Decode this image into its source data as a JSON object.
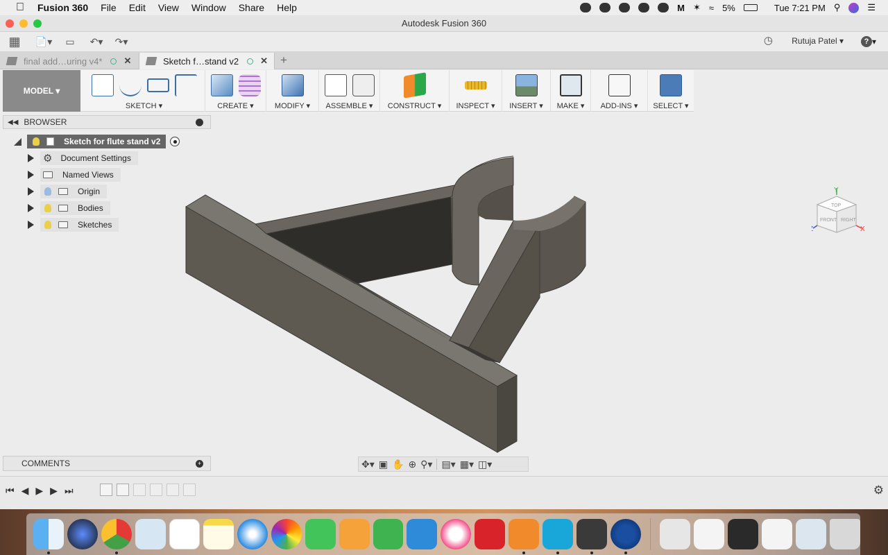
{
  "menubar": {
    "app_name": "Fusion 360",
    "items": [
      "File",
      "Edit",
      "View",
      "Window",
      "Share",
      "Help"
    ],
    "battery": "5%",
    "clock": "Tue 7:21 PM"
  },
  "window": {
    "title": "Autodesk Fusion 360"
  },
  "toolbar": {
    "user": "Rutuja Patel"
  },
  "tabs": [
    {
      "label": "final add…uring v4*",
      "active": false
    },
    {
      "label": "Sketch f…stand v2",
      "active": true
    }
  ],
  "ribbon": {
    "workspace": "MODEL ▾",
    "groups": [
      {
        "label": "SKETCH ▾"
      },
      {
        "label": "CREATE ▾"
      },
      {
        "label": "MODIFY ▾"
      },
      {
        "label": "ASSEMBLE ▾"
      },
      {
        "label": "CONSTRUCT ▾"
      },
      {
        "label": "INSPECT ▾"
      },
      {
        "label": "INSERT ▾"
      },
      {
        "label": "MAKE ▾"
      },
      {
        "label": "ADD-INS ▾"
      },
      {
        "label": "SELECT ▾"
      }
    ]
  },
  "browser": {
    "title": "BROWSER",
    "root": "Sketch for flute stand v2",
    "nodes": [
      {
        "label": "Document Settings",
        "icon": "gear-icon"
      },
      {
        "label": "Named Views",
        "icon": "folder-icon"
      },
      {
        "label": "Origin",
        "icon": "folder-icon",
        "bulb": "#9bbbe0"
      },
      {
        "label": "Bodies",
        "icon": "folder-icon",
        "bulb": "#e8d04a"
      },
      {
        "label": "Sketches",
        "icon": "folder-icon",
        "bulb": "#e8d04a"
      }
    ]
  },
  "viewcube": {
    "top": "TOP",
    "front": "FRONT",
    "right": "RIGHT",
    "axis_y": "Y",
    "axis_x": "X",
    "axis_z": "Z"
  },
  "comments": {
    "title": "COMMENTS"
  },
  "colors": {
    "model_face": "#5e5a52",
    "model_dark": "#4a4741",
    "select_accent": "#4b7cb8"
  }
}
